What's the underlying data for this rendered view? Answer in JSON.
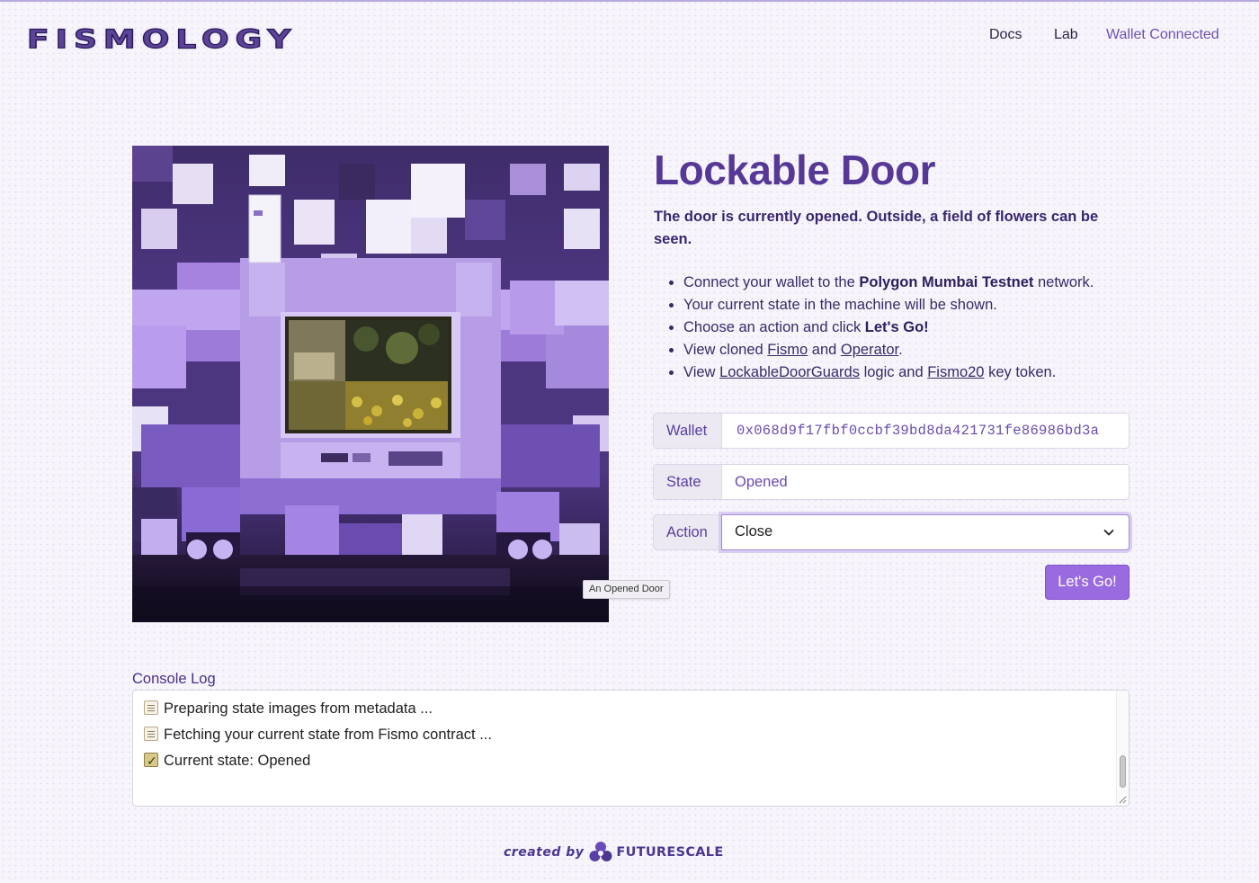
{
  "header": {
    "logo_text": "FISMOLOGY",
    "nav": {
      "docs": "Docs",
      "lab": "Lab",
      "wallet": "Wallet Connected"
    }
  },
  "machine": {
    "image_tooltip": "An Opened Door",
    "title": "Lockable Door",
    "description": "The door is currently opened. Outside, a field of flowers can be seen.",
    "instructions": {
      "item1": {
        "pre": "Connect your wallet to the ",
        "bold": "Polygon Mumbai Testnet",
        "post": " network."
      },
      "item2": {
        "text": "Your current state in the machine will be shown."
      },
      "item3": {
        "pre": "Choose an action and click ",
        "bold": "Let's Go!"
      },
      "item4": {
        "pre": "View cloned ",
        "link1": "Fismo",
        "mid": " and ",
        "link2": "Operator",
        "post": "."
      },
      "item5": {
        "pre": "View ",
        "link1": "LockableDoorGuards",
        "mid": " logic and ",
        "link2": "Fismo20",
        "post": " key token."
      }
    },
    "wallet_label": "Wallet",
    "wallet_address": "0x068d9f17fbf0ccbf39bd8da421731fe86986bd3a",
    "state_label": "State",
    "state_value": "Opened",
    "action_label": "Action",
    "action_selected": "Close",
    "go_button": "Let's Go!"
  },
  "console": {
    "label": "Console Log",
    "lines": [
      {
        "icon": "notepad-icon",
        "text": "Preparing state images from metadata ..."
      },
      {
        "icon": "notepad-icon",
        "text": "Fetching your current state from Fismo contract ..."
      },
      {
        "icon": "check-box-icon",
        "text": "Current state: Opened"
      }
    ]
  },
  "footer": {
    "created_by": "created by",
    "brand": "FUTURESCALE"
  },
  "colors": {
    "accent": "#563997",
    "button": "#9a6be0",
    "link": "#7050b5",
    "background": "#f7f5fb"
  }
}
